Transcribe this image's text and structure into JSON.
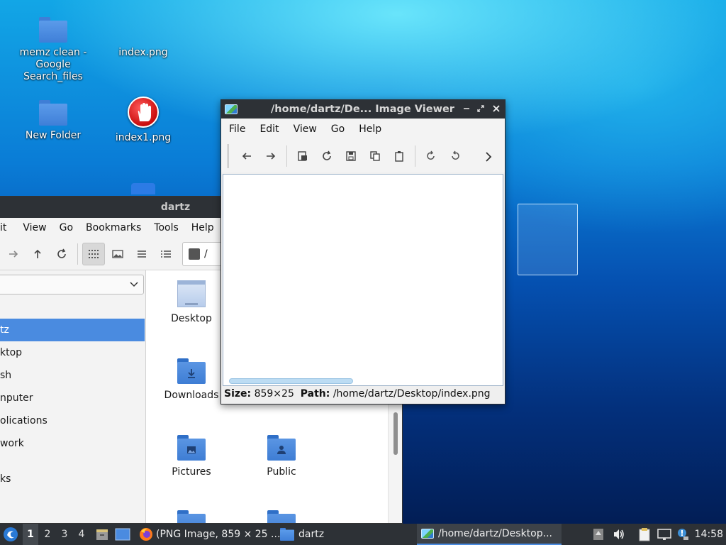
{
  "desktop": {
    "icons": [
      {
        "label": "memz clean - Google Search_files",
        "icon": "folder-icon"
      },
      {
        "label": "index.png",
        "icon": "image-file-icon"
      },
      {
        "label": "New Folder",
        "icon": "folder-icon"
      },
      {
        "label": "index1.png",
        "icon": "stop-hand-icon"
      }
    ]
  },
  "file_manager": {
    "title": "dartz",
    "menu": [
      "it",
      "View",
      "Go",
      "Bookmarks",
      "Tools",
      "Help"
    ],
    "path": "/",
    "sidebar": [
      {
        "label": "tz",
        "selected": true
      },
      {
        "label": "ktop"
      },
      {
        "label": "sh"
      },
      {
        "label": "nputer"
      },
      {
        "label": "olications"
      },
      {
        "label": "work"
      },
      {
        "label": "ks"
      }
    ],
    "items": [
      {
        "label": "Desktop",
        "icon": "desktop-folder-icon"
      },
      {
        "label": "Downloads",
        "icon": "downloads-folder-icon"
      },
      {
        "label": "Pictures",
        "icon": "pictures-folder-icon"
      },
      {
        "label": "Public",
        "icon": "public-folder-icon"
      }
    ]
  },
  "image_viewer": {
    "title": "/home/dartz/De... Image Viewer",
    "menu": [
      "File",
      "Edit",
      "View",
      "Go",
      "Help"
    ],
    "status": {
      "size_label": "Size:",
      "size_value": "859×25",
      "path_label": "Path:",
      "path_value": "/home/dartz/Desktop/index.png"
    },
    "scroll_fraction": 0.46
  },
  "taskbar": {
    "workspaces": [
      "1",
      "2",
      "3",
      "4"
    ],
    "current_workspace": "1",
    "tasks": [
      {
        "label": "(PNG Image, 859 × 25 ...",
        "icon": "firefox-icon"
      },
      {
        "label": "dartz",
        "icon": "folder-icon"
      },
      {
        "label": "/home/dartz/Desktop...",
        "icon": "image-viewer-icon",
        "active": true
      }
    ],
    "clock": "14:58"
  },
  "colors": {
    "accent": "#4a8be0",
    "titlebar": "#2d3136",
    "folder": "#4a88dc"
  }
}
